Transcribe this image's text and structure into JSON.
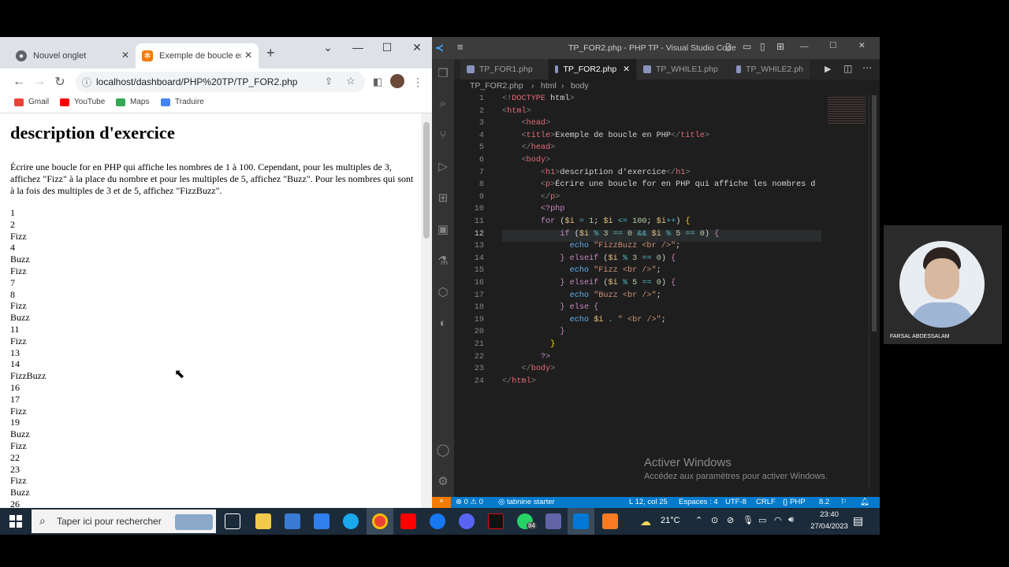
{
  "chrome": {
    "tabs": [
      {
        "label": "Nouvel onglet",
        "active": false
      },
      {
        "label": "Exemple de boucle en P",
        "active": true
      }
    ],
    "url": "localhost/dashboard/PHP%20TP/TP_FOR2.php",
    "bookmarks": [
      "Gmail",
      "YouTube",
      "Maps",
      "Traduire"
    ],
    "page": {
      "heading": "description d'exercice",
      "paragraph": "Écrire une boucle for en PHP qui affiche les nombres de 1 à 100. Cependant, pour les multiples de 3, affichez \"Fizz\" à la place du nombre et pour les multiples de 5, affichez \"Buzz\". Pour les nombres qui sont à la fois des multiples de 3 et de 5, affichez \"FizzBuzz\".",
      "output": [
        "1",
        "2",
        "Fizz",
        "4",
        "Buzz",
        "Fizz",
        "7",
        "8",
        "Fizz",
        "Buzz",
        "11",
        "Fizz",
        "13",
        "14",
        "FizzBuzz",
        "16",
        "17",
        "Fizz",
        "19",
        "Buzz",
        "Fizz",
        "22",
        "23",
        "Fizz",
        "Buzz",
        "26"
      ]
    }
  },
  "vscode": {
    "title": "TP_FOR2.php - PHP TP - Visual Studio Code",
    "tabs": [
      {
        "label": "TP_FOR1.php",
        "active": false
      },
      {
        "label": "TP_FOR2.php",
        "active": true
      },
      {
        "label": "TP_WHILE1.php",
        "active": false
      },
      {
        "label": "TP_WHILE2.ph",
        "active": false
      }
    ],
    "breadcrumb": [
      "TP_FOR2.php",
      "html",
      "body"
    ],
    "current_line": 12,
    "code": [
      [
        [
          "tg",
          "<!"
        ],
        [
          "tn",
          "DOCTYPE"
        ],
        [
          "tx",
          " html"
        ],
        [
          "tg",
          ">"
        ]
      ],
      [
        [
          "tg",
          "<"
        ],
        [
          "tn",
          "html"
        ],
        [
          "tg",
          ">"
        ]
      ],
      [
        [
          "tx",
          "    "
        ],
        [
          "tg",
          "<"
        ],
        [
          "tn",
          "head"
        ],
        [
          "tg",
          ">"
        ]
      ],
      [
        [
          "tx",
          "    "
        ],
        [
          "tg",
          "<"
        ],
        [
          "tn",
          "title"
        ],
        [
          "tg",
          ">"
        ],
        [
          "tx",
          "Exemple de boucle en PHP"
        ],
        [
          "tg",
          "</"
        ],
        [
          "tn",
          "title"
        ],
        [
          "tg",
          ">"
        ]
      ],
      [
        [
          "tx",
          "    "
        ],
        [
          "tg",
          "</"
        ],
        [
          "tn",
          "head"
        ],
        [
          "tg",
          ">"
        ]
      ],
      [
        [
          "tx",
          "    "
        ],
        [
          "tg",
          "<"
        ],
        [
          "tn",
          "body"
        ],
        [
          "tg",
          ">"
        ]
      ],
      [
        [
          "tx",
          "        "
        ],
        [
          "tg",
          "<"
        ],
        [
          "tn",
          "h1"
        ],
        [
          "tg",
          ">"
        ],
        [
          "tx",
          "description d'exercice"
        ],
        [
          "tg",
          "</"
        ],
        [
          "tn",
          "h1"
        ],
        [
          "tg",
          ">"
        ]
      ],
      [
        [
          "tx",
          "        "
        ],
        [
          "tg",
          "<"
        ],
        [
          "tn",
          "p"
        ],
        [
          "tg",
          ">"
        ],
        [
          "tx",
          "Écrire une boucle for en PHP qui affiche les nombres d"
        ]
      ],
      [
        [
          "tx",
          "        "
        ],
        [
          "tg",
          "</"
        ],
        [
          "tn",
          "p"
        ],
        [
          "tg",
          ">"
        ]
      ],
      [
        [
          "tx",
          "        "
        ],
        [
          "ph",
          "<?php"
        ]
      ],
      [
        [
          "tx",
          "        "
        ],
        [
          "kw",
          "for"
        ],
        [
          "tx",
          " ("
        ],
        [
          "vr",
          "$i"
        ],
        [
          "op",
          " = "
        ],
        [
          "nm",
          "1"
        ],
        [
          "tx",
          "; "
        ],
        [
          "vr",
          "$i"
        ],
        [
          "op",
          " <= "
        ],
        [
          "nm",
          "100"
        ],
        [
          "tx",
          "; "
        ],
        [
          "vr",
          "$i"
        ],
        [
          "op",
          "++"
        ],
        [
          "tx",
          ") "
        ],
        [
          "bk",
          "{"
        ]
      ],
      [
        [
          "tx",
          "            "
        ],
        [
          "kw",
          "if"
        ],
        [
          "tx",
          " ("
        ],
        [
          "vr",
          "$i"
        ],
        [
          "op",
          " % "
        ],
        [
          "nm",
          "3"
        ],
        [
          "op",
          " == "
        ],
        [
          "nm",
          "0"
        ],
        [
          "op",
          " && "
        ],
        [
          "vr",
          "$i"
        ],
        [
          "op",
          " % "
        ],
        [
          "nm",
          "5"
        ],
        [
          "op",
          " == "
        ],
        [
          "nm",
          "0"
        ],
        [
          "tx",
          ") "
        ],
        [
          "kw",
          "{"
        ]
      ],
      [
        [
          "tx",
          "              "
        ],
        [
          "ec",
          "echo"
        ],
        [
          "st",
          " \"FizzBuzz <br />\""
        ],
        [
          "tx",
          ";"
        ]
      ],
      [
        [
          "tx",
          "            "
        ],
        [
          "kw",
          "} elseif"
        ],
        [
          "tx",
          " ("
        ],
        [
          "vr",
          "$i"
        ],
        [
          "op",
          " % "
        ],
        [
          "nm",
          "3"
        ],
        [
          "op",
          " == "
        ],
        [
          "nm",
          "0"
        ],
        [
          "tx",
          ") "
        ],
        [
          "kw",
          "{"
        ]
      ],
      [
        [
          "tx",
          "              "
        ],
        [
          "ec",
          "echo"
        ],
        [
          "st",
          " \"Fizz <br />\""
        ],
        [
          "tx",
          ";"
        ]
      ],
      [
        [
          "tx",
          "            "
        ],
        [
          "kw",
          "} elseif"
        ],
        [
          "tx",
          " ("
        ],
        [
          "vr",
          "$i"
        ],
        [
          "op",
          " % "
        ],
        [
          "nm",
          "5"
        ],
        [
          "op",
          " == "
        ],
        [
          "nm",
          "0"
        ],
        [
          "tx",
          ") "
        ],
        [
          "kw",
          "{"
        ]
      ],
      [
        [
          "tx",
          "              "
        ],
        [
          "ec",
          "echo"
        ],
        [
          "st",
          " \"Buzz <br />\""
        ],
        [
          "tx",
          ";"
        ]
      ],
      [
        [
          "tx",
          "            "
        ],
        [
          "kw",
          "} else {"
        ]
      ],
      [
        [
          "tx",
          "              "
        ],
        [
          "ec",
          "echo"
        ],
        [
          "tx",
          " "
        ],
        [
          "vr",
          "$i"
        ],
        [
          "op",
          " . "
        ],
        [
          "st",
          "\" <br />\""
        ],
        [
          "tx",
          ";"
        ]
      ],
      [
        [
          "tx",
          "            "
        ],
        [
          "kw",
          "}"
        ]
      ],
      [
        [
          "tx",
          "          "
        ],
        [
          "bk",
          "}"
        ]
      ],
      [
        [
          "tx",
          "        "
        ],
        [
          "ph",
          "?>"
        ]
      ],
      [
        [
          "tx",
          "    "
        ],
        [
          "tg",
          "</"
        ],
        [
          "tn",
          "body"
        ],
        [
          "tg",
          ">"
        ]
      ],
      [
        [
          "tg",
          "</"
        ],
        [
          "tn",
          "html"
        ],
        [
          "tg",
          ">"
        ]
      ]
    ],
    "watermark": {
      "title": "Activer Windows",
      "subtitle": "Accédez aux paramètres pour activer Windows."
    },
    "status": {
      "problems": "⊗ 0 ⚠ 0",
      "tabnine": "tabnine starter",
      "position": "L 12, col 25",
      "spaces": "Espaces : 4",
      "encoding": "UTF-8",
      "eol": "CRLF",
      "language": "PHP",
      "version": "8.2"
    }
  },
  "webcam": {
    "name": "FARSAL ABDESSALAM"
  },
  "taskbar": {
    "search_placeholder": "Taper ici pour rechercher",
    "weather": "21°C",
    "time": "23:40",
    "date": "27/04/2023",
    "badge": "84"
  },
  "colors": {
    "vscode_accent": "#007acc",
    "chrome_tabbar": "#dee1e6",
    "taskbar": "#1c2b3a"
  }
}
